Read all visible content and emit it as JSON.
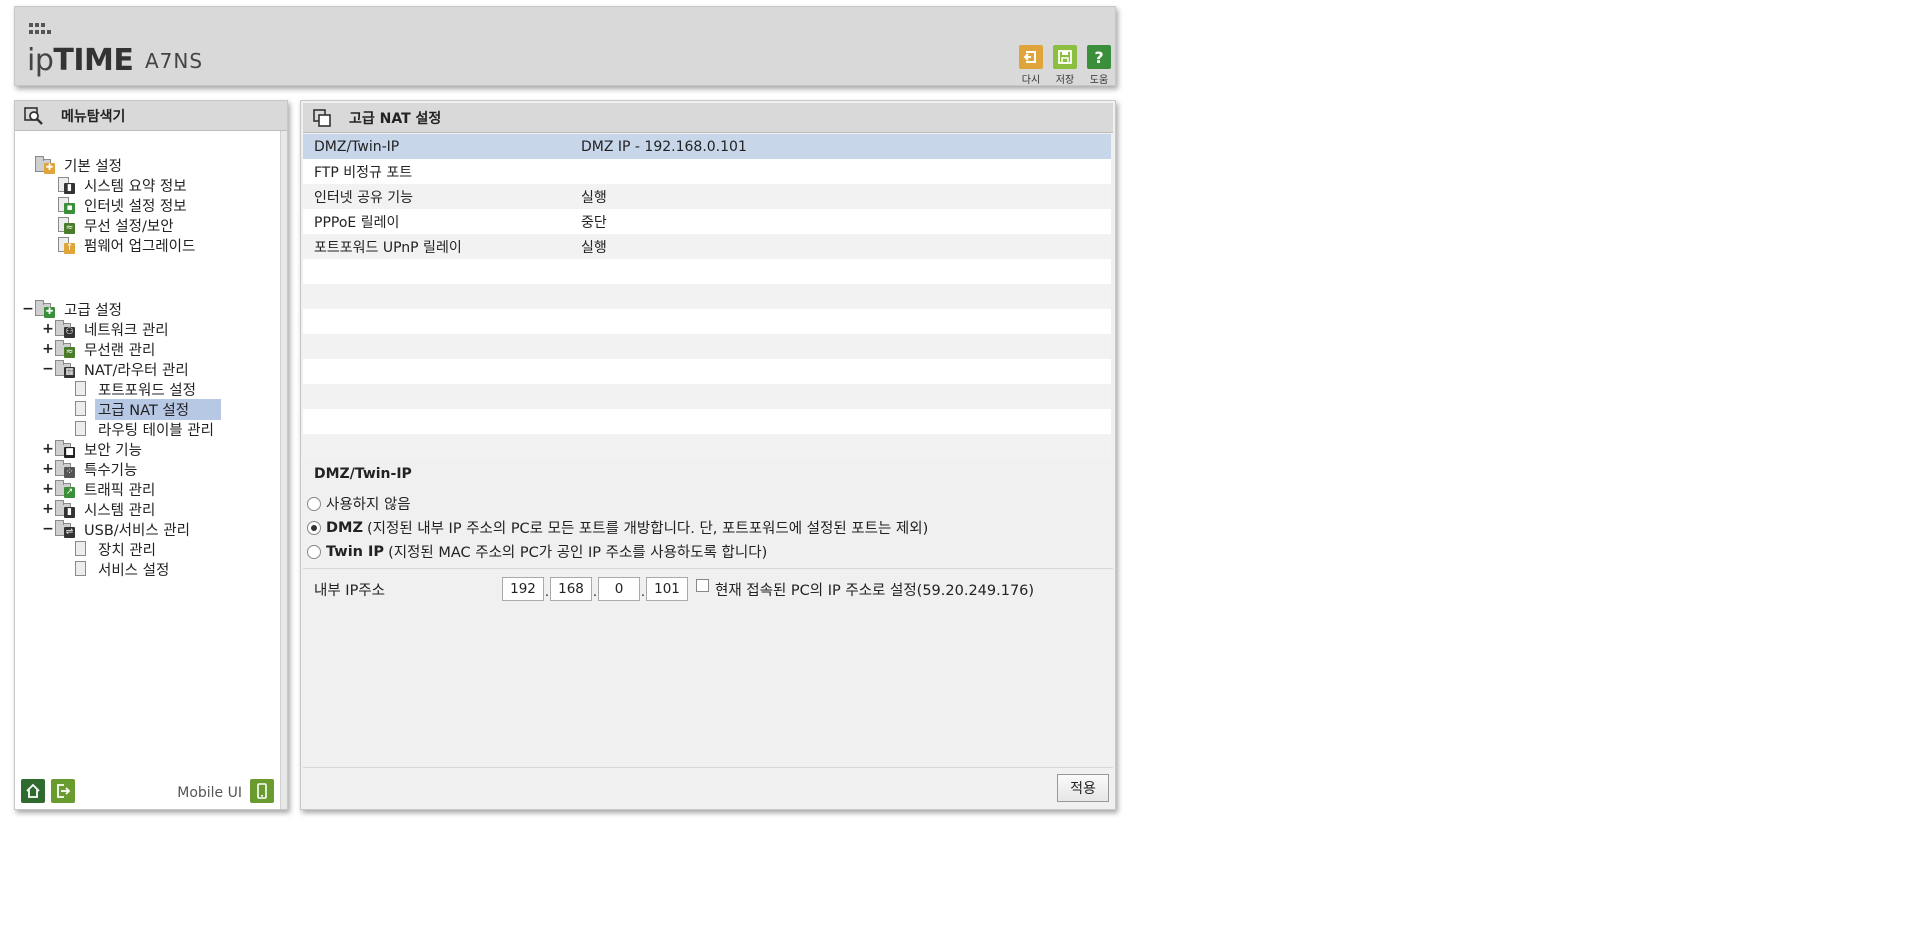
{
  "header": {
    "logo_prefix": "ip",
    "logo_bold": "TIME",
    "model": "A7NS",
    "buttons": [
      {
        "label": "다시",
        "icon": "undo-icon",
        "color": "#e0a53a"
      },
      {
        "label": "저장",
        "icon": "save-icon",
        "color": "#8cbf3f"
      },
      {
        "label": "도움",
        "icon": "help-icon",
        "color": "#3b8f3b"
      }
    ]
  },
  "sidebar": {
    "title": "메뉴탐색기",
    "items": {
      "basic": "기본 설정",
      "sys_summary": "시스템 요약 정보",
      "inet_info": "인터넷 설정 정보",
      "wireless_sec": "무선 설정/보안",
      "firmware": "펌웨어 업그레이드",
      "advanced": "고급 설정",
      "network": "네트워크 관리",
      "wlan": "무선랜 관리",
      "nat_router": "NAT/라우터 관리",
      "portfwd": "포트포워드 설정",
      "adv_nat": "고급 NAT 설정",
      "routing": "라우팅 테이블 관리",
      "security": "보안 기능",
      "special": "특수기능",
      "traffic": "트래픽 관리",
      "system": "시스템 관리",
      "usb": "USB/서비스 관리",
      "device": "장치 관리",
      "service": "서비스 설정"
    },
    "toggles": {
      "expand": "+",
      "collapse": "−"
    },
    "footer": {
      "mobile_ui": "Mobile UI"
    }
  },
  "main": {
    "title": "고급 NAT 설정",
    "status_rows": [
      {
        "key": "DMZ/Twin-IP",
        "value": "DMZ IP - 192.168.0.101"
      },
      {
        "key": "FTP 비정규 포트",
        "value": ""
      },
      {
        "key": "인터넷 공유 기능",
        "value": "실행"
      },
      {
        "key": "PPPoE 릴레이",
        "value": "중단"
      },
      {
        "key": "포트포워드 UPnP 릴레이",
        "value": "실행"
      }
    ],
    "section_title": "DMZ/Twin-IP",
    "radio_disable": "사용하지 않음",
    "radio_dmz_bold": "DMZ",
    "radio_dmz_desc": "(지정된 내부 IP 주소의 PC로 모든 포트를 개방합니다. 단, 포트포워드에 설정된 포트는 제외)",
    "radio_twin_bold": "Twin IP",
    "radio_twin_desc": "(지정된 MAC 주소의 PC가 공인 IP 주소를 사용하도록 합니다)",
    "selected_mode": "DMZ",
    "ip_label": "내부 IP주소",
    "ip": [
      "192",
      "168",
      "0",
      "101"
    ],
    "ip_sep": ".",
    "current_pc_label": "현재 접속된 PC의 IP 주소로 설정(59.20.249.176)",
    "apply": "적용"
  }
}
